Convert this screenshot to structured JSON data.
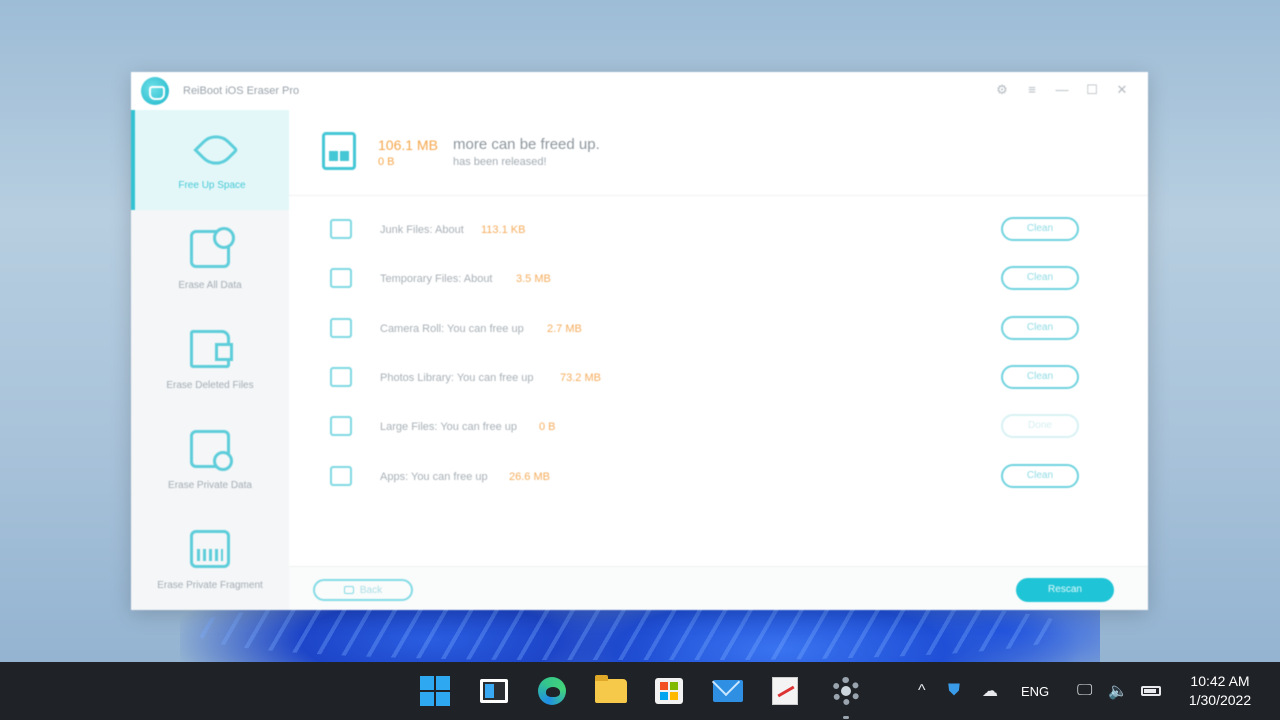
{
  "app": {
    "title": "ReiBoot iOS Eraser Pro",
    "window_controls": {
      "settings_icon": "gear-icon",
      "menu_icon": "menu-icon",
      "minimize": "—",
      "maximize": "☐",
      "close": "✕"
    }
  },
  "sidebar": {
    "items": [
      {
        "label": "Free Up Space",
        "icon": "rocket-icon",
        "active": true
      },
      {
        "label": "Erase All Data",
        "icon": "document-icon",
        "active": false
      },
      {
        "label": "Erase Deleted Files",
        "icon": "folder-icon",
        "active": false
      },
      {
        "label": "Erase Private Data",
        "icon": "privacy-icon",
        "active": false
      },
      {
        "label": "Erase Private Fragment",
        "icon": "shredder-icon",
        "active": false
      }
    ]
  },
  "summary": {
    "value": "106.1 MB",
    "text": "more can be freed up.",
    "sub_value": "0 B",
    "sub_text": "has been released!"
  },
  "rows": [
    {
      "label": "Junk Files: About",
      "value": "113.1 KB",
      "button": "Clean",
      "enabled": true
    },
    {
      "label": "Temporary Files: About",
      "value": "3.5 MB",
      "button": "Clean",
      "enabled": true
    },
    {
      "label": "Camera Roll: You can free up",
      "value": "2.7 MB",
      "button": "Clean",
      "enabled": true
    },
    {
      "label": "Photos Library: You can free up",
      "value": "73.2 MB",
      "button": "Clean",
      "enabled": true
    },
    {
      "label": "Large Files: You can free up",
      "value": "0 B",
      "button": "Done",
      "enabled": false
    },
    {
      "label": "Apps: You can free up",
      "value": "26.6 MB",
      "button": "Clean",
      "enabled": true
    }
  ],
  "footer": {
    "back_label": "Back",
    "rescan_label": "Rescan"
  },
  "taskbar": {
    "apps": [
      "windows-start-icon",
      "snap-layout-icon",
      "edge-icon",
      "file-explorer-icon",
      "store-icon",
      "mail-icon",
      "app-icon",
      "settings-icon"
    ],
    "tray": {
      "chevron": "^",
      "language": "ENG",
      "time": "10:42 AM",
      "date": "1/30/2022"
    }
  },
  "colors": {
    "accent": "#1fc4d6",
    "value_orange": "#f5a64a",
    "taskbar": "#1f2226"
  }
}
